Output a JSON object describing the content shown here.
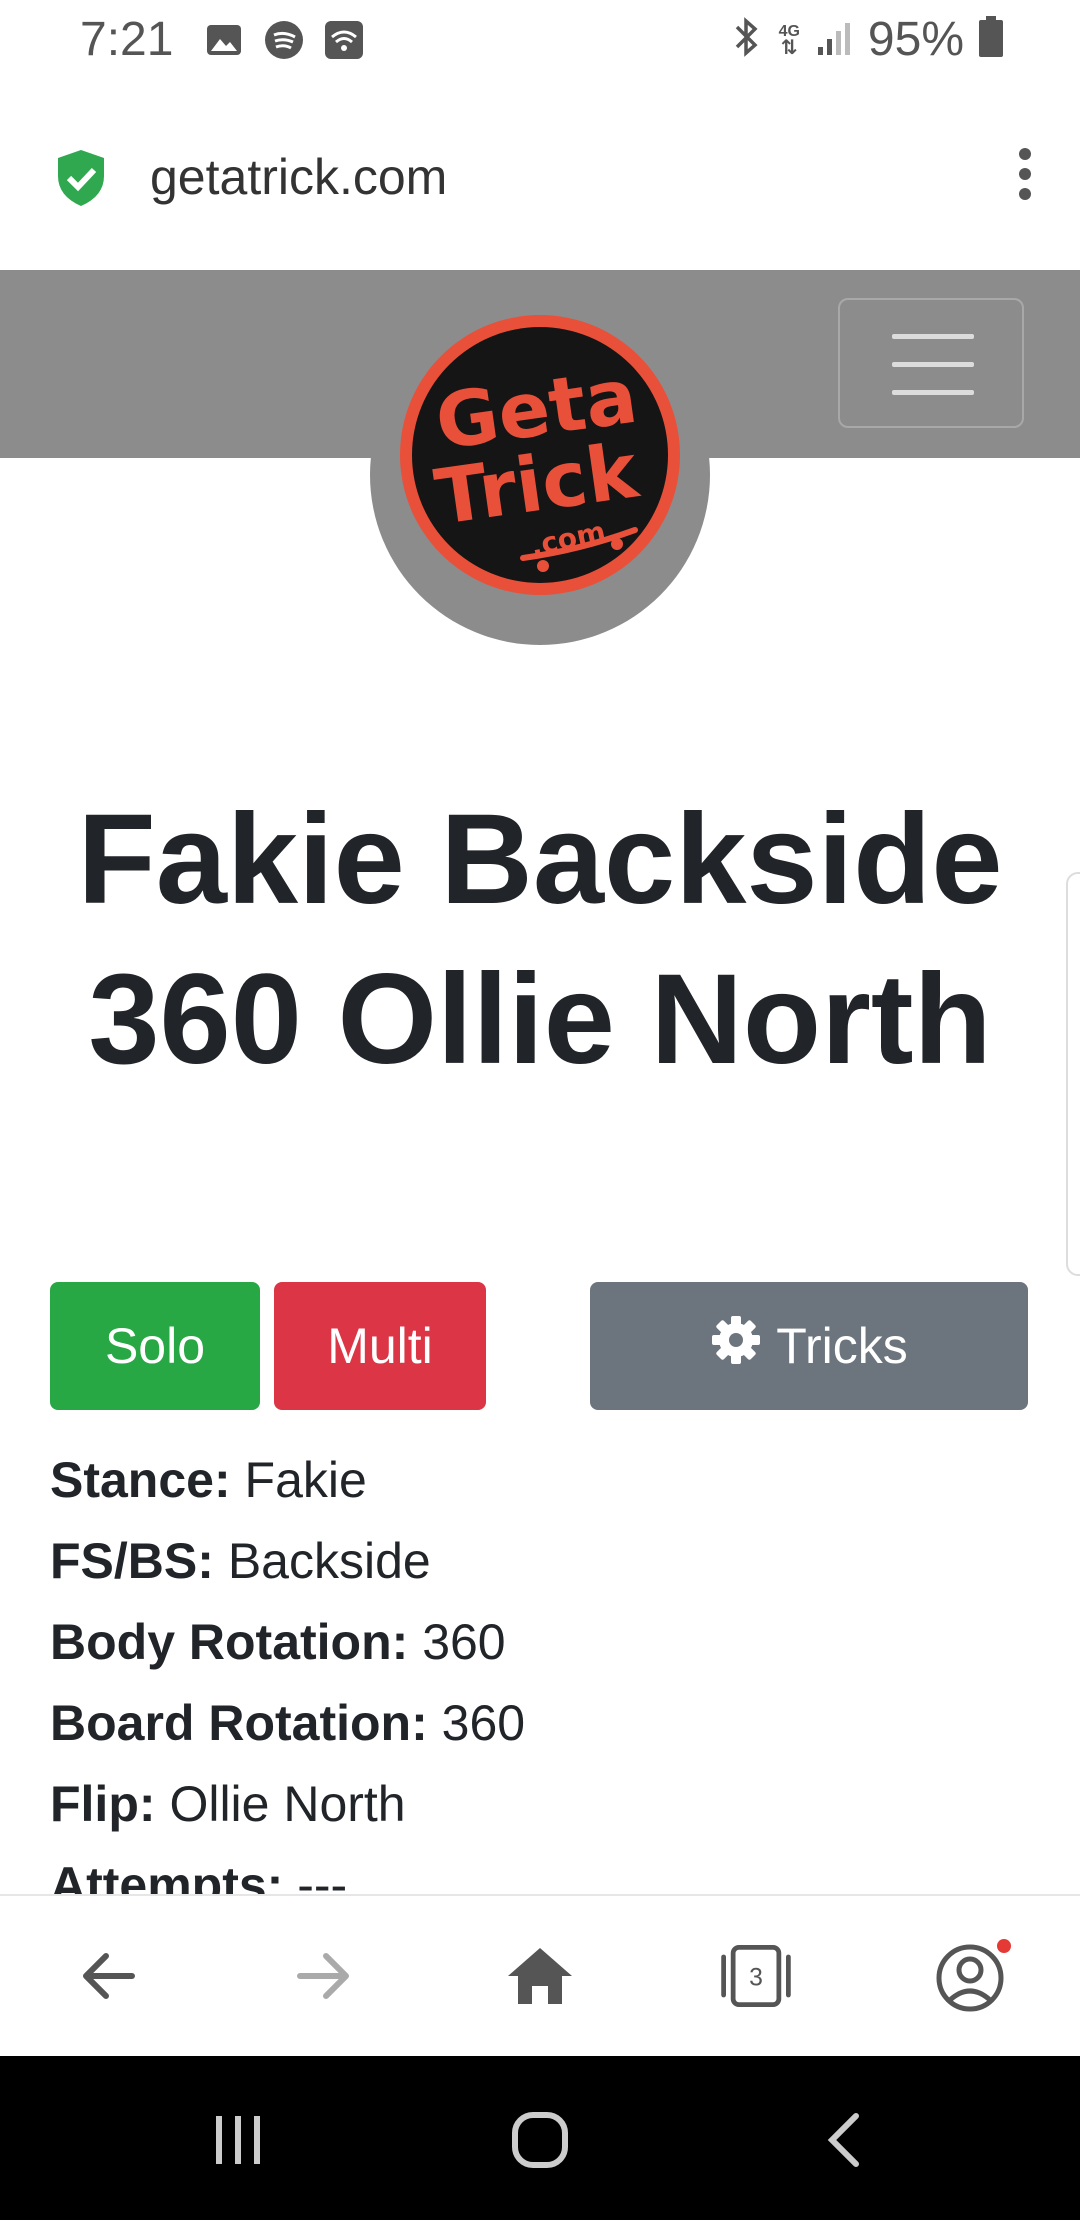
{
  "status_bar": {
    "time": "7:21",
    "battery": "95%",
    "network": "4G"
  },
  "browser": {
    "url": "getatrick.com",
    "tab_count": "3"
  },
  "header": {
    "logo_lines": [
      "Geta",
      "Trick",
      ".com"
    ]
  },
  "trick": {
    "title": "Fakie Backside 360 Ollie North"
  },
  "buttons": {
    "solo": "Solo",
    "multi": "Multi",
    "tricks": "Tricks"
  },
  "details": [
    {
      "label": "Stance:",
      "value": "Fakie"
    },
    {
      "label": "FS/BS:",
      "value": "Backside"
    },
    {
      "label": "Body Rotation:",
      "value": "360"
    },
    {
      "label": "Board Rotation:",
      "value": "360"
    },
    {
      "label": "Flip:",
      "value": "Ollie North"
    },
    {
      "label": "Attempts:",
      "value": "---"
    }
  ],
  "colors": {
    "solo": "#28a745",
    "multi": "#dc3545",
    "tricks": "#6c757d",
    "header": "#8c8c8c",
    "logo_accent": "#e8503a"
  }
}
